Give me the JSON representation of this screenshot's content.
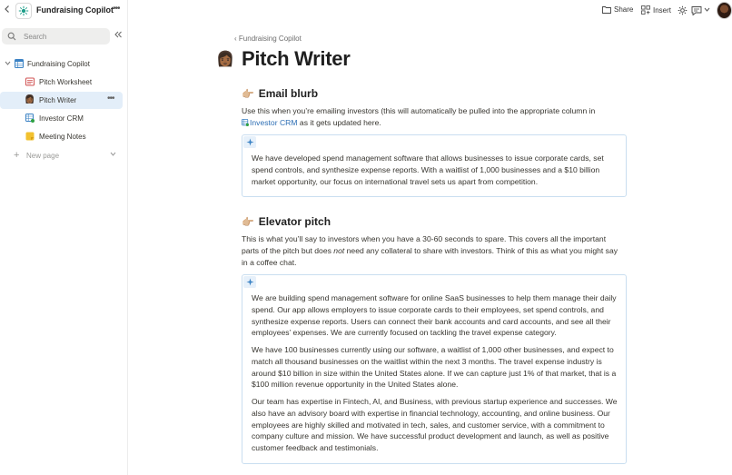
{
  "workspace": {
    "title": "Fundraising Copilot"
  },
  "search": {
    "placeholder": "Search"
  },
  "tree": {
    "root": "Fundraising Copilot",
    "items": [
      {
        "label": "Pitch Worksheet",
        "icon": "worksheet-icon"
      },
      {
        "label": "Pitch Writer",
        "icon": "person-emoji-icon"
      },
      {
        "label": "Investor CRM",
        "icon": "crm-table-icon"
      },
      {
        "label": "Meeting Notes",
        "icon": "notes-icon"
      }
    ],
    "new_page": "New page"
  },
  "topbar": {
    "share": "Share",
    "insert": "Insert"
  },
  "page": {
    "breadcrumb": "Fundraising Copilot",
    "title": "Pitch Writer",
    "emoji": "👩🏾"
  },
  "sections": {
    "email": {
      "heading": "Email blurb",
      "intro_1": "Use this when you’re emailing investors (this will automatically be pulled into the appropriate column in",
      "intro_link": "Investor CRM",
      "intro_2": "as it gets updated here.",
      "callout": "We have developed spend management software that allows businesses to issue corporate cards, set spend controls, and synthesize expense reports. With a waitlist of 1,000 businesses and a $10 billion market opportunity, our focus on international travel sets us apart from competition."
    },
    "elevator": {
      "heading": "Elevator pitch",
      "intro_1": "This is what you’ll say to investors when you have a 30-60 seconds to spare. This covers all the important parts of the pitch but does",
      "intro_em": "not",
      "intro_2": "need any collateral to share with investors. Think of this as what you might say in a coffee chat.",
      "p1": "We are building spend management software for online SaaS businesses to help them manage their daily spend. Our app allows employers to issue corporate cards to their employees, set spend controls, and synthesize expense reports. Users can connect their bank accounts and card accounts, and see all their employees’ expenses. We are currently focused on tackling the travel expense category.",
      "p2": "We have 100 businesses currently using our software, a waitlist of 1,000 other businesses, and expect to match all thousand businesses on the waitlist within the next 3 months. The travel expense industry is around $10 billion in size within the United States alone. If we can capture just 1% of that market, that is a $100 million revenue opportunity in the United States alone.",
      "p3": "Our team has expertise in Fintech, AI, and Business, with previous startup experience and successes. We also have an advisory board with expertise in financial technology, accounting, and online business. Our employees are highly skilled and motivated in tech, sales, and customer service, with a commitment to company culture and mission. We have successful product development and launch, as well as positive customer feedback and testimonials."
    }
  },
  "colors": {
    "accent": "#2e6fb5",
    "active_item_bg": "#e3eef9",
    "callout_border": "#c9def0"
  }
}
